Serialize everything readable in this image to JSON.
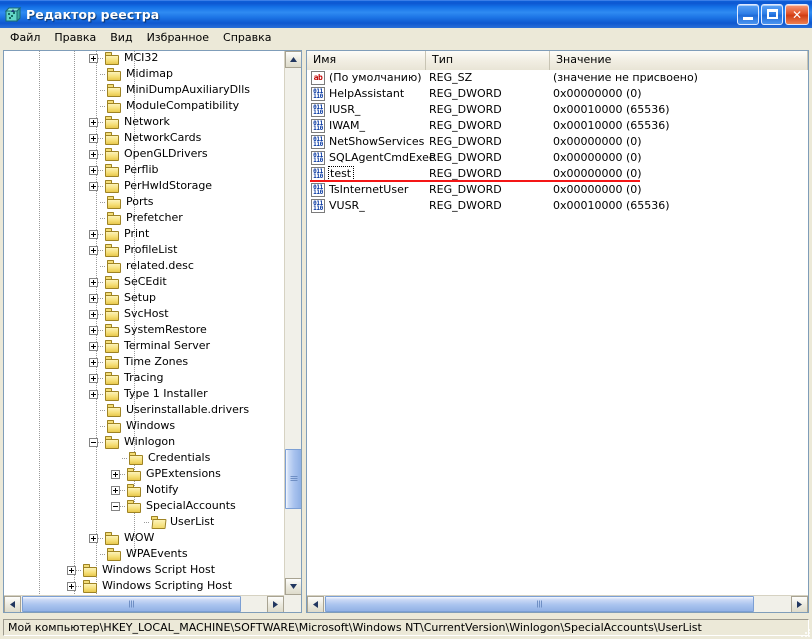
{
  "window": {
    "title": "Редактор реестра",
    "icon": "registry-editor-icon",
    "minimize_label": "_",
    "maximize_label": "□",
    "close_label": "✕"
  },
  "menu": {
    "items": [
      {
        "label": "Файл"
      },
      {
        "label": "Правка"
      },
      {
        "label": "Вид"
      },
      {
        "label": "Избранное"
      },
      {
        "label": "Справка"
      }
    ]
  },
  "tree": {
    "nodes": [
      {
        "label": "MCI32",
        "depth": 4,
        "expander": "plus",
        "state": "collapsed"
      },
      {
        "label": "Midimap",
        "depth": 4,
        "expander": "none",
        "state": "leaf"
      },
      {
        "label": "MiniDumpAuxiliaryDlls",
        "depth": 4,
        "expander": "none",
        "state": "leaf"
      },
      {
        "label": "ModuleCompatibility",
        "depth": 4,
        "expander": "none",
        "state": "leaf"
      },
      {
        "label": "Network",
        "depth": 4,
        "expander": "plus",
        "state": "collapsed"
      },
      {
        "label": "NetworkCards",
        "depth": 4,
        "expander": "plus",
        "state": "collapsed"
      },
      {
        "label": "OpenGLDrivers",
        "depth": 4,
        "expander": "plus",
        "state": "collapsed"
      },
      {
        "label": "Perflib",
        "depth": 4,
        "expander": "plus",
        "state": "collapsed"
      },
      {
        "label": "PerHwIdStorage",
        "depth": 4,
        "expander": "plus",
        "state": "collapsed"
      },
      {
        "label": "Ports",
        "depth": 4,
        "expander": "none",
        "state": "leaf"
      },
      {
        "label": "Prefetcher",
        "depth": 4,
        "expander": "none",
        "state": "leaf"
      },
      {
        "label": "Print",
        "depth": 4,
        "expander": "plus",
        "state": "collapsed"
      },
      {
        "label": "ProfileList",
        "depth": 4,
        "expander": "plus",
        "state": "collapsed"
      },
      {
        "label": "related.desc",
        "depth": 4,
        "expander": "none",
        "state": "leaf"
      },
      {
        "label": "SeCEdit",
        "depth": 4,
        "expander": "plus",
        "state": "collapsed"
      },
      {
        "label": "Setup",
        "depth": 4,
        "expander": "plus",
        "state": "collapsed"
      },
      {
        "label": "SvcHost",
        "depth": 4,
        "expander": "plus",
        "state": "collapsed"
      },
      {
        "label": "SystemRestore",
        "depth": 4,
        "expander": "plus",
        "state": "collapsed"
      },
      {
        "label": "Terminal Server",
        "depth": 4,
        "expander": "plus",
        "state": "collapsed"
      },
      {
        "label": "Time Zones",
        "depth": 4,
        "expander": "plus",
        "state": "collapsed"
      },
      {
        "label": "Tracing",
        "depth": 4,
        "expander": "plus",
        "state": "collapsed"
      },
      {
        "label": "Type 1 Installer",
        "depth": 4,
        "expander": "plus",
        "state": "collapsed"
      },
      {
        "label": "Userinstallable.drivers",
        "depth": 4,
        "expander": "none",
        "state": "leaf"
      },
      {
        "label": "Windows",
        "depth": 4,
        "expander": "none",
        "state": "leaf"
      },
      {
        "label": "Winlogon",
        "depth": 4,
        "expander": "minus",
        "state": "expanded"
      },
      {
        "label": "Credentials",
        "depth": 5,
        "expander": "none",
        "state": "leaf"
      },
      {
        "label": "GPExtensions",
        "depth": 5,
        "expander": "plus",
        "state": "collapsed"
      },
      {
        "label": "Notify",
        "depth": 5,
        "expander": "plus",
        "state": "collapsed"
      },
      {
        "label": "SpecialAccounts",
        "depth": 5,
        "expander": "minus",
        "state": "expanded"
      },
      {
        "label": "UserList",
        "depth": 6,
        "expander": "none",
        "state": "selected"
      },
      {
        "label": "WOW",
        "depth": 4,
        "expander": "plus",
        "state": "collapsed"
      },
      {
        "label": "WPAEvents",
        "depth": 4,
        "expander": "none",
        "state": "leaf"
      },
      {
        "label": "Windows Script Host",
        "depth": 3,
        "expander": "plus",
        "state": "collapsed"
      },
      {
        "label": "Windows Scripting Host",
        "depth": 3,
        "expander": "plus",
        "state": "collapsed"
      }
    ],
    "scrollbar": {
      "up_arrow": "▲",
      "down_arrow": "▼",
      "left_arrow": "◄",
      "right_arrow": "►"
    }
  },
  "list": {
    "columns": [
      {
        "label": "Имя"
      },
      {
        "label": "Тип"
      },
      {
        "label": "Значение"
      }
    ],
    "rows": [
      {
        "name": "(По умолчанию)",
        "type": "REG_SZ",
        "value": "(значение не присвоено)",
        "icon": "reg-sz-icon",
        "focused": false
      },
      {
        "name": "HelpAssistant",
        "type": "REG_DWORD",
        "value": "0x00000000 (0)",
        "icon": "reg-dword-icon",
        "focused": false
      },
      {
        "name": "IUSR_",
        "type": "REG_DWORD",
        "value": "0x00010000 (65536)",
        "icon": "reg-dword-icon",
        "focused": false
      },
      {
        "name": "IWAM_",
        "type": "REG_DWORD",
        "value": "0x00010000 (65536)",
        "icon": "reg-dword-icon",
        "focused": false
      },
      {
        "name": "NetShowServices",
        "type": "REG_DWORD",
        "value": "0x00000000 (0)",
        "icon": "reg-dword-icon",
        "focused": false
      },
      {
        "name": "SQLAgentCmdExec",
        "type": "REG_DWORD",
        "value": "0x00000000 (0)",
        "icon": "reg-dword-icon",
        "focused": false
      },
      {
        "name": "test",
        "type": "REG_DWORD",
        "value": "0x00000000 (0)",
        "icon": "reg-dword-icon",
        "focused": true
      },
      {
        "name": "TsInternetUser",
        "type": "REG_DWORD",
        "value": "0x00000000 (0)",
        "icon": "reg-dword-icon",
        "focused": false
      },
      {
        "name": "VUSR_",
        "type": "REG_DWORD",
        "value": "0x00010000 (65536)",
        "icon": "reg-dword-icon",
        "focused": false
      }
    ],
    "annotation": {
      "type": "underline",
      "color": "#f41616",
      "target_row": "test"
    },
    "icon_text": {
      "sz": "ab",
      "dword_top": "011",
      "dword_bottom": "110"
    }
  },
  "statusbar": {
    "path": "Мой компьютер\\HKEY_LOCAL_MACHINE\\SOFTWARE\\Microsoft\\Windows NT\\CurrentVersion\\Winlogon\\SpecialAccounts\\UserList"
  },
  "colors": {
    "title_blue": "#1470e6",
    "face": "#ece9d8",
    "annotation_red": "#f41616",
    "folder_yellow": "#f6e07a"
  }
}
